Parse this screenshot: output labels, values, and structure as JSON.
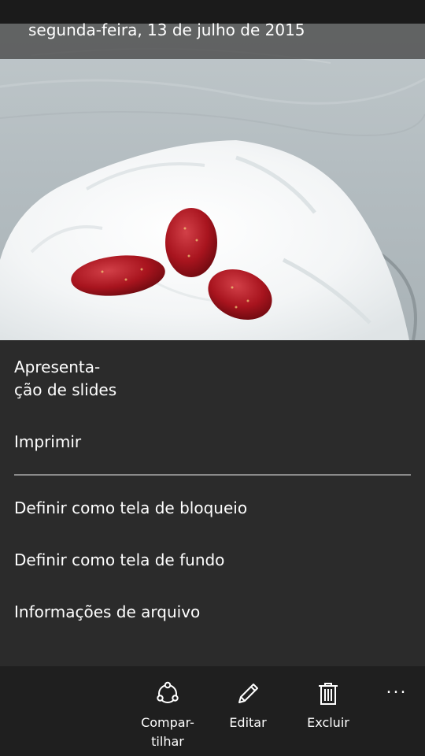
{
  "photo": {
    "date": "segunda-feira, 13 de julho de 2015",
    "subject": "cake-with-strawberries-photo"
  },
  "menu": {
    "items": [
      {
        "label_lines": [
          "Apresenta-",
          "ção de slides"
        ]
      },
      {
        "label": "Imprimir"
      },
      {
        "label": "Definir como tela de bloqueio"
      },
      {
        "label": "Definir como tela de fundo"
      },
      {
        "label": "Informações de arquivo"
      }
    ]
  },
  "app_bar": {
    "share": {
      "label_lines": [
        "Compar-",
        "tilhar"
      ],
      "icon": "share-icon"
    },
    "edit": {
      "label": "Editar",
      "icon": "pencil-icon"
    },
    "delete": {
      "label": "Excluir",
      "icon": "trash-icon"
    },
    "more": {
      "label": "...",
      "icon": "more-icon"
    }
  },
  "colors": {
    "menu_background": "#2b2b2b",
    "app_bar_background": "#1f1f1f",
    "status_bar_background": "#1b1b1b",
    "divider": "#8a8a8a",
    "text": "#ffffff"
  }
}
